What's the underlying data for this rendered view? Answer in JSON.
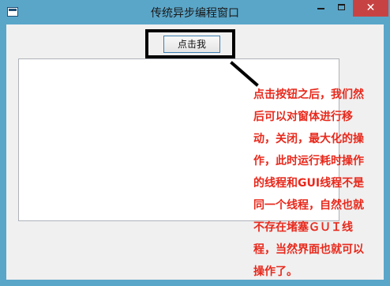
{
  "window": {
    "title": "传统异步编程窗口",
    "minimize_label": "",
    "maximize_label": "",
    "close_label": "✕"
  },
  "form": {
    "button_label": "点击我",
    "textbox_value": ""
  },
  "annotation": {
    "text": "点击按钮之后，我们然\n后可以对窗体进行移\n动，关闭，最大化的操\n作，此时运行耗时操作\n的线程和GUI线程不是\n同一个线程，自然也就\n不存在堵塞ＧＵＩ线\n程，当然界面也就可以\n操作了。"
  },
  "colors": {
    "annotation": "#e8291c",
    "titlebar": "#5aa6c9",
    "close_button": "#c74343",
    "highlight_box": "#000000"
  },
  "icons": {
    "app": "app-window-icon",
    "minimize": "minimize-icon",
    "maximize": "maximize-icon",
    "close": "close-icon"
  }
}
